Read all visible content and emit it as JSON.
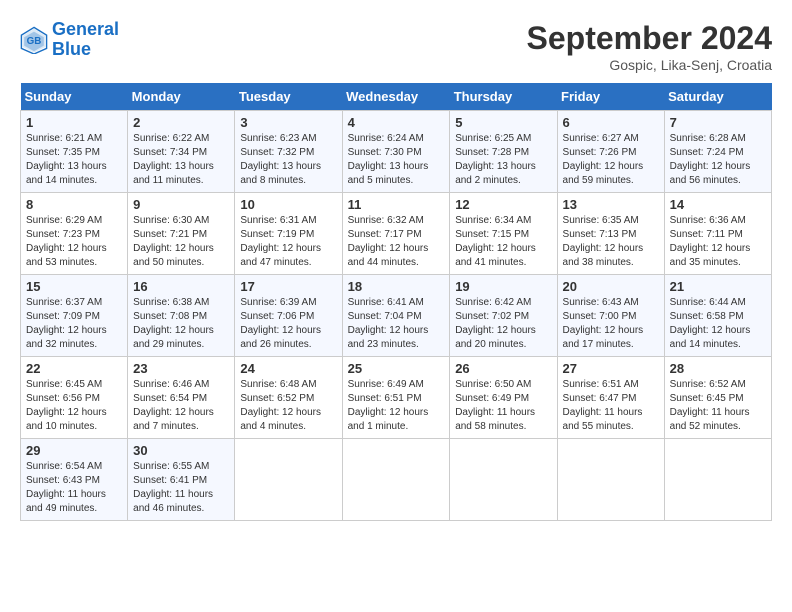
{
  "logo": {
    "line1": "General",
    "line2": "Blue"
  },
  "title": "September 2024",
  "subtitle": "Gospic, Lika-Senj, Croatia",
  "days_of_week": [
    "Sunday",
    "Monday",
    "Tuesday",
    "Wednesday",
    "Thursday",
    "Friday",
    "Saturday"
  ],
  "weeks": [
    [
      {
        "day": "1",
        "info": "Sunrise: 6:21 AM\nSunset: 7:35 PM\nDaylight: 13 hours and 14 minutes."
      },
      {
        "day": "2",
        "info": "Sunrise: 6:22 AM\nSunset: 7:34 PM\nDaylight: 13 hours and 11 minutes."
      },
      {
        "day": "3",
        "info": "Sunrise: 6:23 AM\nSunset: 7:32 PM\nDaylight: 13 hours and 8 minutes."
      },
      {
        "day": "4",
        "info": "Sunrise: 6:24 AM\nSunset: 7:30 PM\nDaylight: 13 hours and 5 minutes."
      },
      {
        "day": "5",
        "info": "Sunrise: 6:25 AM\nSunset: 7:28 PM\nDaylight: 13 hours and 2 minutes."
      },
      {
        "day": "6",
        "info": "Sunrise: 6:27 AM\nSunset: 7:26 PM\nDaylight: 12 hours and 59 minutes."
      },
      {
        "day": "7",
        "info": "Sunrise: 6:28 AM\nSunset: 7:24 PM\nDaylight: 12 hours and 56 minutes."
      }
    ],
    [
      {
        "day": "8",
        "info": "Sunrise: 6:29 AM\nSunset: 7:23 PM\nDaylight: 12 hours and 53 minutes."
      },
      {
        "day": "9",
        "info": "Sunrise: 6:30 AM\nSunset: 7:21 PM\nDaylight: 12 hours and 50 minutes."
      },
      {
        "day": "10",
        "info": "Sunrise: 6:31 AM\nSunset: 7:19 PM\nDaylight: 12 hours and 47 minutes."
      },
      {
        "day": "11",
        "info": "Sunrise: 6:32 AM\nSunset: 7:17 PM\nDaylight: 12 hours and 44 minutes."
      },
      {
        "day": "12",
        "info": "Sunrise: 6:34 AM\nSunset: 7:15 PM\nDaylight: 12 hours and 41 minutes."
      },
      {
        "day": "13",
        "info": "Sunrise: 6:35 AM\nSunset: 7:13 PM\nDaylight: 12 hours and 38 minutes."
      },
      {
        "day": "14",
        "info": "Sunrise: 6:36 AM\nSunset: 7:11 PM\nDaylight: 12 hours and 35 minutes."
      }
    ],
    [
      {
        "day": "15",
        "info": "Sunrise: 6:37 AM\nSunset: 7:09 PM\nDaylight: 12 hours and 32 minutes."
      },
      {
        "day": "16",
        "info": "Sunrise: 6:38 AM\nSunset: 7:08 PM\nDaylight: 12 hours and 29 minutes."
      },
      {
        "day": "17",
        "info": "Sunrise: 6:39 AM\nSunset: 7:06 PM\nDaylight: 12 hours and 26 minutes."
      },
      {
        "day": "18",
        "info": "Sunrise: 6:41 AM\nSunset: 7:04 PM\nDaylight: 12 hours and 23 minutes."
      },
      {
        "day": "19",
        "info": "Sunrise: 6:42 AM\nSunset: 7:02 PM\nDaylight: 12 hours and 20 minutes."
      },
      {
        "day": "20",
        "info": "Sunrise: 6:43 AM\nSunset: 7:00 PM\nDaylight: 12 hours and 17 minutes."
      },
      {
        "day": "21",
        "info": "Sunrise: 6:44 AM\nSunset: 6:58 PM\nDaylight: 12 hours and 14 minutes."
      }
    ],
    [
      {
        "day": "22",
        "info": "Sunrise: 6:45 AM\nSunset: 6:56 PM\nDaylight: 12 hours and 10 minutes."
      },
      {
        "day": "23",
        "info": "Sunrise: 6:46 AM\nSunset: 6:54 PM\nDaylight: 12 hours and 7 minutes."
      },
      {
        "day": "24",
        "info": "Sunrise: 6:48 AM\nSunset: 6:52 PM\nDaylight: 12 hours and 4 minutes."
      },
      {
        "day": "25",
        "info": "Sunrise: 6:49 AM\nSunset: 6:51 PM\nDaylight: 12 hours and 1 minute."
      },
      {
        "day": "26",
        "info": "Sunrise: 6:50 AM\nSunset: 6:49 PM\nDaylight: 11 hours and 58 minutes."
      },
      {
        "day": "27",
        "info": "Sunrise: 6:51 AM\nSunset: 6:47 PM\nDaylight: 11 hours and 55 minutes."
      },
      {
        "day": "28",
        "info": "Sunrise: 6:52 AM\nSunset: 6:45 PM\nDaylight: 11 hours and 52 minutes."
      }
    ],
    [
      {
        "day": "29",
        "info": "Sunrise: 6:54 AM\nSunset: 6:43 PM\nDaylight: 11 hours and 49 minutes."
      },
      {
        "day": "30",
        "info": "Sunrise: 6:55 AM\nSunset: 6:41 PM\nDaylight: 11 hours and 46 minutes."
      },
      null,
      null,
      null,
      null,
      null
    ]
  ]
}
